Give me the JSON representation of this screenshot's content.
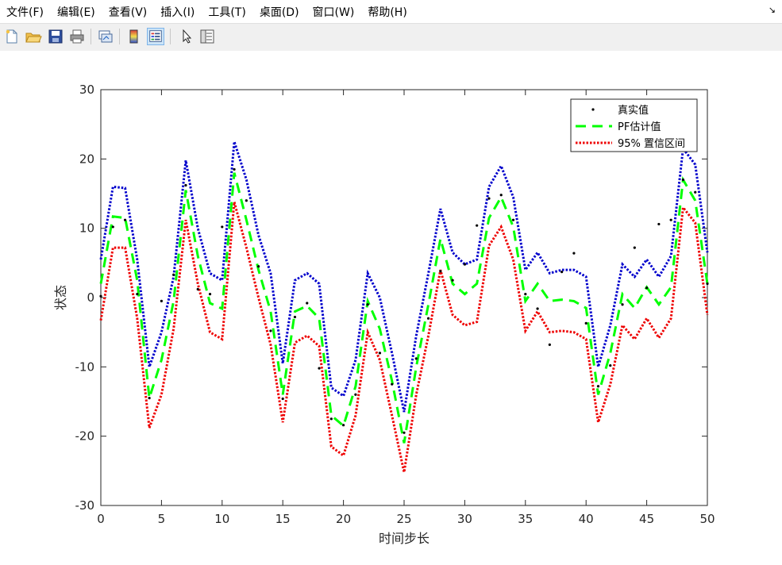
{
  "menu": {
    "items": [
      "文件(F)",
      "编辑(E)",
      "查看(V)",
      "插入(I)",
      "工具(T)",
      "桌面(D)",
      "窗口(W)",
      "帮助(H)"
    ],
    "dock_glyph": "↘"
  },
  "toolbar": {
    "icons": [
      "new-figure-icon",
      "open-file-icon",
      "save-icon",
      "print-icon",
      "link-plot-icon",
      "insert-colorbar-icon",
      "insert-legend-icon",
      "edit-plot-pointer-icon",
      "property-inspector-icon"
    ]
  },
  "colors": {
    "true_value": "#000000",
    "estimate": "#00ff00",
    "upper": "#0000cc",
    "lower": "#ee0000",
    "axes": "#262626"
  },
  "chart_data": {
    "type": "line",
    "xlabel": "时间步长",
    "ylabel": "状态",
    "title": "",
    "xlim": [
      0,
      50
    ],
    "ylim": [
      -30,
      30
    ],
    "xticks": [
      0,
      5,
      10,
      15,
      20,
      25,
      30,
      35,
      40,
      45,
      50
    ],
    "yticks": [
      -30,
      -20,
      -10,
      0,
      10,
      20,
      30
    ],
    "grid": false,
    "legend_position": "top-right",
    "x": [
      0,
      1,
      2,
      3,
      4,
      5,
      6,
      7,
      8,
      9,
      10,
      11,
      12,
      13,
      14,
      15,
      16,
      17,
      18,
      19,
      20,
      21,
      22,
      23,
      24,
      25,
      26,
      27,
      28,
      29,
      30,
      31,
      32,
      33,
      34,
      35,
      36,
      37,
      38,
      39,
      40,
      41,
      42,
      43,
      44,
      45,
      46,
      47,
      48,
      49,
      50
    ],
    "series": [
      {
        "name": "真实值",
        "style": "points",
        "values": [
          0.2,
          10.2,
          11.2,
          0.5,
          -14.5,
          -0.5,
          3.3,
          16.2,
          1.2,
          0.5,
          10.2,
          18.5,
          14.0,
          4.5,
          -4.8,
          -14.6,
          -2.8,
          -0.8,
          -10.2,
          -17.5,
          -18.4,
          -14.0,
          -1.0,
          -8.0,
          -12.5,
          -19.5,
          -8.8,
          -3.0,
          3.8,
          2.5,
          4.8,
          10.4,
          14.3,
          14.8,
          11.2,
          0.5,
          -1.6,
          -6.8,
          3.7,
          6.4,
          -3.7,
          -12.8,
          -9.8,
          -1.0,
          7.2,
          1.4,
          10.6,
          11.2,
          17.0,
          15.2,
          2.0
        ]
      },
      {
        "name": "PF估计值",
        "style": "dashed",
        "values": [
          2.0,
          11.7,
          11.5,
          2.5,
          -14.5,
          -9.0,
          -0.5,
          15.5,
          6.0,
          -0.8,
          -1.6,
          18.0,
          11.2,
          4.0,
          -2.0,
          -14.0,
          -2.0,
          -1.2,
          -3.0,
          -17.0,
          -18.5,
          -12.8,
          -0.5,
          -4.5,
          -12.0,
          -21.0,
          -10.0,
          -1.0,
          8.5,
          2.0,
          0.5,
          2.0,
          11.5,
          14.5,
          10.2,
          -0.5,
          2.0,
          -0.5,
          -0.3,
          -0.5,
          -1.5,
          -14.0,
          -8.0,
          0.5,
          -1.5,
          1.5,
          -1.0,
          1.5,
          17.0,
          14.0,
          2.0
        ]
      },
      {
        "name": "95% 置信区间",
        "style": "dotted",
        "role": "upper",
        "values": [
          5.5,
          16.0,
          15.8,
          5.5,
          -10.0,
          -5.0,
          3.0,
          19.8,
          10.0,
          3.5,
          2.5,
          22.5,
          17.0,
          9.0,
          3.5,
          -9.5,
          2.5,
          3.5,
          2.0,
          -13.0,
          -14.2,
          -9.0,
          3.5,
          0.0,
          -8.0,
          -16.5,
          -5.5,
          3.5,
          12.8,
          6.5,
          4.8,
          5.5,
          16.0,
          19.0,
          14.5,
          4.0,
          6.5,
          3.5,
          4.0,
          4.0,
          3.0,
          -10.0,
          -4.0,
          4.8,
          3.0,
          5.5,
          3.0,
          6.0,
          21.5,
          19.2,
          6.5
        ]
      },
      {
        "name": "95% 置信区间",
        "style": "dotted",
        "role": "lower",
        "values": [
          -3.3,
          7.2,
          7.2,
          -3.0,
          -18.8,
          -14.0,
          -4.5,
          11.2,
          2.0,
          -5.0,
          -6.0,
          13.8,
          7.2,
          0.0,
          -6.8,
          -18.0,
          -6.5,
          -5.5,
          -7.0,
          -21.5,
          -22.8,
          -17.0,
          -5.0,
          -9.0,
          -17.0,
          -25.2,
          -14.0,
          -5.5,
          4.0,
          -2.5,
          -4.0,
          -3.5,
          7.5,
          10.2,
          5.5,
          -4.8,
          -2.0,
          -5.0,
          -4.8,
          -5.0,
          -6.0,
          -18.0,
          -12.5,
          -4.0,
          -6.0,
          -3.0,
          -5.8,
          -3.0,
          13.0,
          10.8,
          -2.5
        ]
      }
    ],
    "legend": [
      "真实值",
      "PF估计值",
      "95% 置信区间"
    ]
  }
}
